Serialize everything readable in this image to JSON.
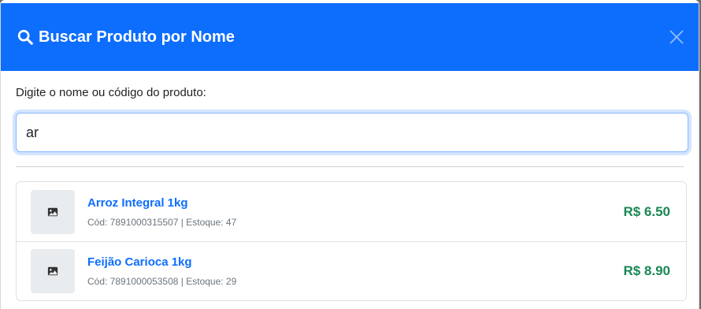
{
  "modal": {
    "title": "Buscar Produto por Nome"
  },
  "search": {
    "label": "Digite o nome ou código do produto:",
    "value": "ar"
  },
  "results": [
    {
      "name": "Arroz Integral 1kg",
      "code_label": "Cód:",
      "code": "7891000315507",
      "stock_label": "Estoque:",
      "stock": "47",
      "meta": "Cód: 7891000315507 | Estoque: 47",
      "price": "R$ 6.50"
    },
    {
      "name": "Feijão Carioca 1kg",
      "code_label": "Cód:",
      "code": "7891000053508",
      "stock_label": "Estoque:",
      "stock": "29",
      "meta": "Cód: 7891000053508 | Estoque: 29",
      "price": "R$ 8.90"
    }
  ],
  "colors": {
    "header": "#0d6efd",
    "link": "#0d6efd",
    "price": "#198754"
  },
  "icons": {
    "title_icon": "search-icon",
    "close": "close-icon",
    "thumb": "image-icon"
  }
}
